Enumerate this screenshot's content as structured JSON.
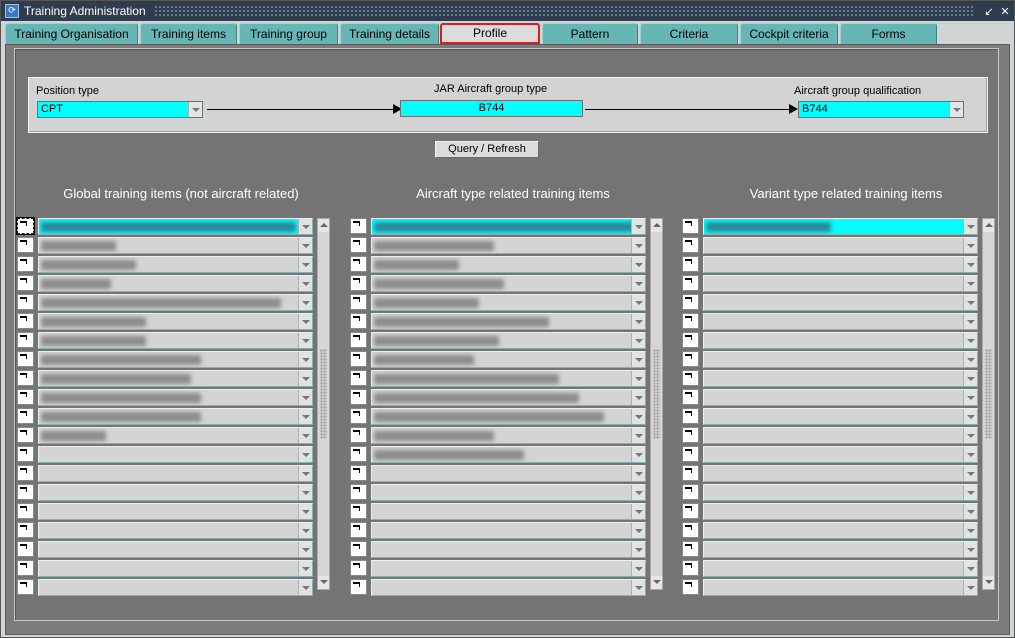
{
  "window": {
    "title": "Training Administration",
    "controls": [
      "↙",
      "✕"
    ]
  },
  "tabs": [
    {
      "label": "Training Organisation",
      "active": false
    },
    {
      "label": "Training items",
      "active": false
    },
    {
      "label": "Training group",
      "active": false
    },
    {
      "label": "Training details",
      "active": false
    },
    {
      "label": "Profile",
      "active": true
    },
    {
      "label": "Pattern",
      "active": false
    },
    {
      "label": "Criteria",
      "active": false
    },
    {
      "label": "Cockpit criteria",
      "active": false
    },
    {
      "label": "Forms",
      "active": false
    }
  ],
  "profile": {
    "position_type": {
      "label": "Position type",
      "value": "CPT"
    },
    "jar_group_type": {
      "label": "JAR Aircraft group type",
      "value": "B744"
    },
    "group_qualification": {
      "label": "Aircraft group qualification",
      "value": "B744"
    },
    "query_button": "Query / Refresh"
  },
  "columns": [
    {
      "heading": "Global training items (not aircraft related)",
      "filled_rows": 12,
      "total_rows": 20
    },
    {
      "heading": "Aircraft type related training items",
      "filled_rows": 13,
      "total_rows": 20
    },
    {
      "heading": "Variant type related training items",
      "filled_rows": 1,
      "total_rows": 20
    }
  ],
  "colors": {
    "titlebar": "#2f3c4d",
    "tab": "#66b6b6",
    "highlight": "#00ffff",
    "active_tab_border": "#d81e1e"
  }
}
